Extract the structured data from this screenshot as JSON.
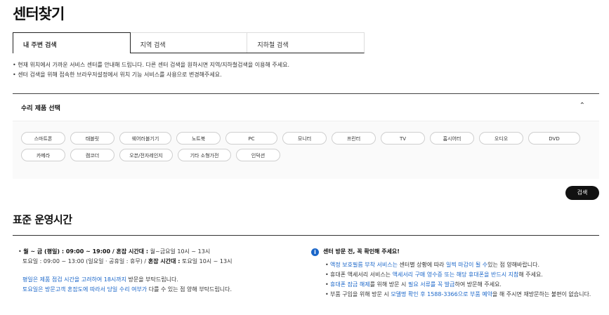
{
  "page": {
    "title": "센터찾기"
  },
  "tabs": [
    "내 주변 검색",
    "지역 검색",
    "지하철 검색"
  ],
  "notes": [
    "현재 위치에서 가까운 서비스 센터를 안내해 드립니다. 다른 센터 검색을 원하시면 지역/지하철검색을 이용해 주세요.",
    "센터 검색을 위해 접속한 브라우저설정에서 위치 기능 서비스를 사용으로 변경해주세요."
  ],
  "repair": {
    "title": "수리 제품 선택",
    "caret": "⌃",
    "products": [
      "스마트폰",
      "태블릿",
      "웨어러블기기",
      "노트북",
      "PC",
      "모니터",
      "프린터",
      "TV",
      "홈시어터",
      "오디오",
      "DVD",
      "카메라",
      "캠코더",
      "오븐/전자레인지",
      "기타 소형가전",
      "인덕션"
    ]
  },
  "search_button": "검색",
  "hours": {
    "title": "표준 운영시간",
    "line1_a": "월 ~ 금 (평일) : 09:00 ~ 19:00 / 혼잡 시간대 :",
    "line1_b": " 월~금요일 10시 ~ 13시",
    "line2_a": "토요일 : 09:00 ~ 13:00 (일요일 · 공휴일 : 휴무) /",
    "line2_b": " 혼잡 시간대 :",
    "line2_c": " 토요일 10시 ~ 13시",
    "note1_a": "평일은 제품 점검 시간을 고려하여 18시까지",
    "note1_b": " 방문을 부탁드립니다.",
    "note2_a": "토요일은 방문고객 혼잡도에 따라서 당일 수리 여부가",
    "note2_b": " 다를 수 있는 점 양해 부탁드립니다."
  },
  "notice": {
    "icon": "i",
    "title": "센터 방문 전, 꼭 확인해 주세요!",
    "item1_a": "액정 보호필름 부착 서비스는",
    "item1_b": " 센터별 상황에 따라 ",
    "item1_c": "일찍 마감이 될 수",
    "item1_d": "있는 점 양해바랍니다.",
    "item2_a": "휴대폰 액세서리 서비스는 ",
    "item2_b": "액세서리 구매 영수증 또는 해당 휴대폰을 반드시 지참",
    "item2_c": "해 주세요.",
    "item3_a": "휴대폰 잠금 해제",
    "item3_b": "를 위해 방문 시 ",
    "item3_c": "필요 서류를 꼭 발급",
    "item3_d": "하여 방문해 주세요.",
    "item4_a": "부품 구입을 위해 방문 시 ",
    "item4_b": "모델명 확인 후 1588-3366으로 부품 예약",
    "item4_c": "을 해 주시면 재방문하는 불편이 없습니다."
  }
}
